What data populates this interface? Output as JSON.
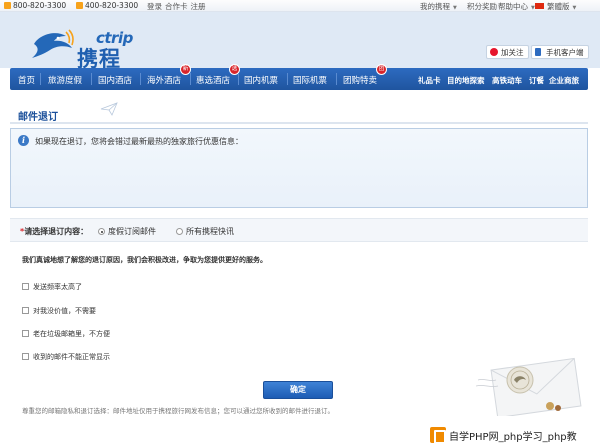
{
  "topbar": {
    "phone1": "800-820-3300",
    "phone2": "400-820-3300",
    "links": [
      "登录",
      "合作卡",
      "注册"
    ],
    "my_ctrip": "我的携程",
    "rewards": "积分奖励",
    "help": "帮助中心",
    "language": "繁體版"
  },
  "header": {
    "logo_en": "ctrip",
    "logo_cn": "携程",
    "follow_label": "加关注",
    "mobile_label": "手机客户端"
  },
  "nav": {
    "items": [
      {
        "label": "首页"
      },
      {
        "label": "旅游度假"
      },
      {
        "label": "国内酒店"
      },
      {
        "label": "海外酒店",
        "badge": "新"
      },
      {
        "label": "惠选酒店",
        "badge": "选"
      },
      {
        "label": "国内机票"
      },
      {
        "label": "国际机票"
      },
      {
        "label": "团购特卖",
        "badge": "团"
      }
    ],
    "right_items": [
      "礼品卡",
      "目的地探索",
      "高铁动车",
      "订餐",
      "企业商旅"
    ]
  },
  "page": {
    "title": "邮件退订",
    "info_text": "如果现在退订，您将会错过最新最热的独家旅行优惠信息：",
    "select_label": "请选择退订内容：",
    "required_mark": "*",
    "radio_options": [
      {
        "label": "度假订阅邮件",
        "checked": true
      },
      {
        "label": "所有携程快讯",
        "checked": false
      }
    ],
    "sorry_text": "我们真诚地想了解您的退订原因，我们会积极改进，争取为您提供更好的服务。",
    "reasons": [
      "发送频率太高了",
      "对我没价值，不需要",
      "老在垃圾邮箱里，不方便",
      "收到的邮件不能正常显示"
    ],
    "confirm_label": "确定",
    "footnote": "尊重您的邮箱隐私和退订选择：邮件地址仅用于携程旅行网发布信息；您可以通过您所收到的邮件进行退订。"
  },
  "watermark": {
    "text": "自学PHP网_php学习_php教"
  },
  "colors": {
    "nav_blue": "#1f559f",
    "title_blue": "#1a4f9a",
    "badge_red": "#d9252b"
  }
}
